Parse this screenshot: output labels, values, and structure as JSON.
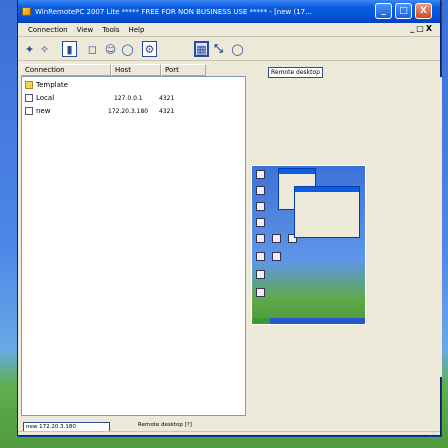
{
  "window": {
    "title": "WinRemotePC 2007 Lite  ***** FREE FOR NON BUSINESS USE *****  - [new (17...",
    "minimize_label": "_",
    "maximize_label": "□",
    "close_label": "X"
  },
  "menu": {
    "items": [
      "Connection",
      "View",
      "Tools",
      "Help"
    ],
    "mdi_controls": [
      "_",
      "□",
      "X"
    ]
  },
  "toolbar": {
    "buttons": [
      "connect",
      "disconnect",
      "properties",
      "screenshot",
      "chat",
      "refresh",
      "settings",
      "view-mode",
      "zoom",
      "info"
    ]
  },
  "tree": {
    "headers": [
      "Connection",
      "Host",
      "Port"
    ],
    "items": [
      {
        "label": "Template",
        "icon": "folder-icon",
        "host": "",
        "port": ""
      },
      {
        "label": "Local",
        "icon": "computer-icon",
        "host": "127.0.0.1",
        "port": "4321"
      },
      {
        "label": "new",
        "icon": "computer-icon",
        "host": "172.20.3.180",
        "port": "4321"
      }
    ]
  },
  "remote": {
    "tab_label": "Remote desktop",
    "bottom_label": "Remote desktop  [?]"
  },
  "status": {
    "tab_label": "new 172.20.3.180"
  },
  "colors": {
    "title_bar": "#0454d8",
    "window_bg": "#ece9d8",
    "desktop_top": "#3a6fd8",
    "desktop_grass": "#4f9a3c"
  }
}
